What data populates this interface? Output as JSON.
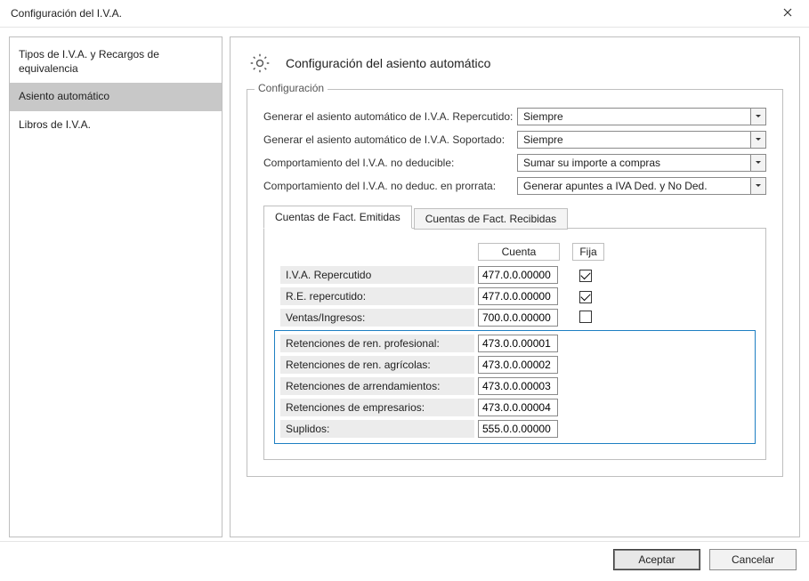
{
  "window": {
    "title": "Configuración del I.V.A."
  },
  "sidebar": {
    "items": [
      {
        "label": "Tipos de I.V.A. y Recargos de equivalencia",
        "selected": false
      },
      {
        "label": "Asiento automático",
        "selected": true
      },
      {
        "label": "Libros de I.V.A.",
        "selected": false
      }
    ]
  },
  "page": {
    "title": "Configuración del asiento automático",
    "group_label": "Configuración"
  },
  "settings": {
    "rows": [
      {
        "label": "Generar el asiento automático de I.V.A. Repercutido:",
        "value": "Siempre"
      },
      {
        "label": "Generar el asiento automático de I.V.A. Soportado:",
        "value": "Siempre"
      },
      {
        "label": "Comportamiento del I.V.A. no deducible:",
        "value": "Sumar su importe a compras"
      },
      {
        "label": "Comportamiento del I.V.A. no deduc. en prorrata:",
        "value": "Generar apuntes a IVA Ded. y No Ded."
      }
    ]
  },
  "tabs": {
    "items": [
      {
        "label": "Cuentas de Fact. Emitidas",
        "active": true
      },
      {
        "label": "Cuentas de Fact. Recibidas",
        "active": false
      }
    ]
  },
  "grid": {
    "headers": {
      "cuenta": "Cuenta",
      "fija": "Fija"
    },
    "rows": [
      {
        "label": "I.V.A. Repercutido",
        "cuenta": "477.0.0.00000",
        "fija": true,
        "highlight": false
      },
      {
        "label": "R.E. repercutido:",
        "cuenta": "477.0.0.00000",
        "fija": true,
        "highlight": false
      },
      {
        "label": "Ventas/Ingresos:",
        "cuenta": "700.0.0.00000",
        "fija": false,
        "highlight": false
      },
      {
        "label": "Retenciones de ren. profesional:",
        "cuenta": "473.0.0.00001",
        "fija": null,
        "highlight": true
      },
      {
        "label": "Retenciones de ren. agrícolas:",
        "cuenta": "473.0.0.00002",
        "fija": null,
        "highlight": true
      },
      {
        "label": "Retenciones de arrendamientos:",
        "cuenta": "473.0.0.00003",
        "fija": null,
        "highlight": true
      },
      {
        "label": "Retenciones de empresarios:",
        "cuenta": "473.0.0.00004",
        "fija": null,
        "highlight": true
      },
      {
        "label": "Suplidos:",
        "cuenta": "555.0.0.00000",
        "fija": null,
        "highlight": true
      }
    ]
  },
  "footer": {
    "ok": "Aceptar",
    "cancel": "Cancelar"
  }
}
